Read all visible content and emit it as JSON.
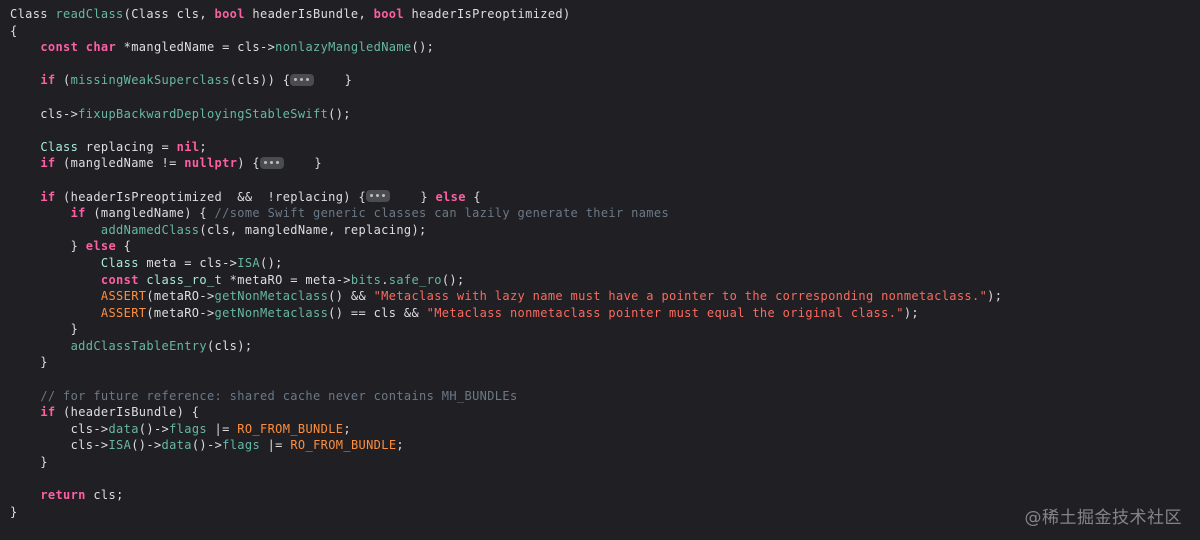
{
  "colors": {
    "background": "#1f1f24",
    "keyword": "#fc5fa3",
    "type": "#a7ebdd",
    "function": "#67b7a4",
    "macro": "#fd8f3f",
    "string": "#fc6a5d",
    "comment": "#6c7986",
    "plain": "#dfdfe0"
  },
  "code": {
    "lines": [
      [
        [
          "cls",
          "Class"
        ],
        [
          "txt",
          " "
        ],
        [
          "fn",
          "readClass"
        ],
        [
          "txt",
          "("
        ],
        [
          "cls",
          "Class"
        ],
        [
          "txt",
          " cls, "
        ],
        [
          "kw",
          "bool"
        ],
        [
          "txt",
          " headerIsBundle, "
        ],
        [
          "kw",
          "bool"
        ],
        [
          "txt",
          " headerIsPreoptimized)"
        ]
      ],
      [
        [
          "txt",
          "{"
        ]
      ],
      [
        [
          "txt",
          "    "
        ],
        [
          "kw",
          "const"
        ],
        [
          "txt",
          " "
        ],
        [
          "kw",
          "char"
        ],
        [
          "txt",
          " *mangledName = cls->"
        ],
        [
          "fn",
          "nonlazyMangledName"
        ],
        [
          "txt",
          "();"
        ]
      ],
      [],
      [
        [
          "txt",
          "    "
        ],
        [
          "kw",
          "if"
        ],
        [
          "txt",
          " ("
        ],
        [
          "fn",
          "missingWeakSuperclass"
        ],
        [
          "txt",
          "(cls)) {"
        ],
        [
          "fold",
          ""
        ],
        [
          "txt",
          "    }"
        ]
      ],
      [],
      [
        [
          "txt",
          "    cls->"
        ],
        [
          "fn",
          "fixupBackwardDeployingStableSwift"
        ],
        [
          "txt",
          "();"
        ]
      ],
      [],
      [
        [
          "txt",
          "    "
        ],
        [
          "ty",
          "Class"
        ],
        [
          "txt",
          " replacing = "
        ],
        [
          "kw",
          "nil"
        ],
        [
          "txt",
          ";"
        ]
      ],
      [
        [
          "txt",
          "    "
        ],
        [
          "kw",
          "if"
        ],
        [
          "txt",
          " (mangledName != "
        ],
        [
          "kw",
          "nullptr"
        ],
        [
          "txt",
          ") {"
        ],
        [
          "fold",
          ""
        ],
        [
          "txt",
          "    }"
        ]
      ],
      [],
      [
        [
          "txt",
          "    "
        ],
        [
          "kw",
          "if"
        ],
        [
          "txt",
          " (headerIsPreoptimized  &&  !replacing) {"
        ],
        [
          "fold",
          ""
        ],
        [
          "txt",
          "    } "
        ],
        [
          "kw",
          "else"
        ],
        [
          "txt",
          " {"
        ]
      ],
      [
        [
          "txt",
          "        "
        ],
        [
          "kw",
          "if"
        ],
        [
          "txt",
          " (mangledName) { "
        ],
        [
          "cmt",
          "//some Swift generic classes can lazily generate their names"
        ]
      ],
      [
        [
          "txt",
          "            "
        ],
        [
          "fn",
          "addNamedClass"
        ],
        [
          "txt",
          "(cls, mangledName, replacing);"
        ]
      ],
      [
        [
          "txt",
          "        } "
        ],
        [
          "kw",
          "else"
        ],
        [
          "txt",
          " {"
        ]
      ],
      [
        [
          "txt",
          "            "
        ],
        [
          "ty",
          "Class"
        ],
        [
          "txt",
          " meta = cls->"
        ],
        [
          "fn",
          "ISA"
        ],
        [
          "txt",
          "();"
        ]
      ],
      [
        [
          "txt",
          "            "
        ],
        [
          "kw",
          "const"
        ],
        [
          "txt",
          " "
        ],
        [
          "ty",
          "class_ro_t"
        ],
        [
          "txt",
          " *metaRO = meta->"
        ],
        [
          "fn",
          "bits"
        ],
        [
          "txt",
          "."
        ],
        [
          "fn",
          "safe_ro"
        ],
        [
          "txt",
          "();"
        ]
      ],
      [
        [
          "txt",
          "            "
        ],
        [
          "mac",
          "ASSERT"
        ],
        [
          "txt",
          "(metaRO->"
        ],
        [
          "fn",
          "getNonMetaclass"
        ],
        [
          "txt",
          "() && "
        ],
        [
          "str",
          "\"Metaclass with lazy name must have a pointer to the corresponding nonmetaclass.\""
        ],
        [
          "txt",
          ");"
        ]
      ],
      [
        [
          "txt",
          "            "
        ],
        [
          "mac",
          "ASSERT"
        ],
        [
          "txt",
          "(metaRO->"
        ],
        [
          "fn",
          "getNonMetaclass"
        ],
        [
          "txt",
          "() == cls && "
        ],
        [
          "str",
          "\"Metaclass nonmetaclass pointer must equal the original class.\""
        ],
        [
          "txt",
          ");"
        ]
      ],
      [
        [
          "txt",
          "        }"
        ]
      ],
      [
        [
          "txt",
          "        "
        ],
        [
          "fn",
          "addClassTableEntry"
        ],
        [
          "txt",
          "(cls);"
        ]
      ],
      [
        [
          "txt",
          "    }"
        ]
      ],
      [],
      [
        [
          "txt",
          "    "
        ],
        [
          "cmt",
          "// for future reference: shared cache never contains MH_BUNDLEs"
        ]
      ],
      [
        [
          "txt",
          "    "
        ],
        [
          "kw",
          "if"
        ],
        [
          "txt",
          " (headerIsBundle) {"
        ]
      ],
      [
        [
          "txt",
          "        cls->"
        ],
        [
          "fn",
          "data"
        ],
        [
          "txt",
          "()->"
        ],
        [
          "fn",
          "flags"
        ],
        [
          "txt",
          " |= "
        ],
        [
          "mac",
          "RO_FROM_BUNDLE"
        ],
        [
          "txt",
          ";"
        ]
      ],
      [
        [
          "txt",
          "        cls->"
        ],
        [
          "fn",
          "ISA"
        ],
        [
          "txt",
          "()->"
        ],
        [
          "fn",
          "data"
        ],
        [
          "txt",
          "()->"
        ],
        [
          "fn",
          "flags"
        ],
        [
          "txt",
          " |= "
        ],
        [
          "mac",
          "RO_FROM_BUNDLE"
        ],
        [
          "txt",
          ";"
        ]
      ],
      [
        [
          "txt",
          "    }"
        ]
      ],
      [],
      [
        [
          "txt",
          "    "
        ],
        [
          "kw",
          "return"
        ],
        [
          "txt",
          " cls;"
        ]
      ],
      [
        [
          "txt",
          "}"
        ]
      ]
    ]
  },
  "watermark": {
    "text": "@稀土掘金技术社区"
  }
}
